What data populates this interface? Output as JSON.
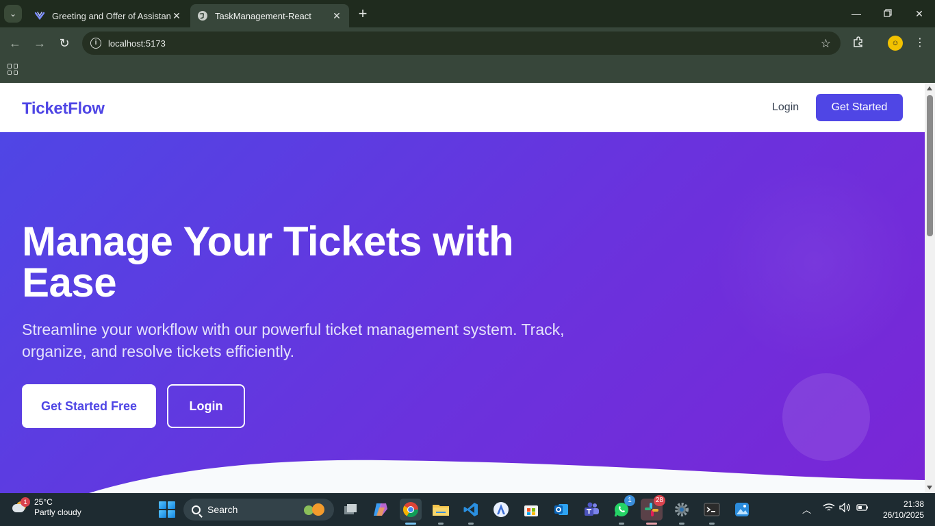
{
  "browser": {
    "tabs": [
      {
        "title": "Greeting and Offer of Assistance",
        "active": false
      },
      {
        "title": "TaskManagement-React",
        "active": true
      }
    ],
    "address": "localhost:5173"
  },
  "site": {
    "brand": "TicketFlow",
    "nav": {
      "login": "Login",
      "cta": "Get Started"
    }
  },
  "hero": {
    "headline": "Manage Your Tickets with Ease",
    "subtitle": "Streamline your workflow with our powerful ticket management system. Track, organize, and resolve tickets efficiently.",
    "primary_button": "Get Started Free",
    "secondary_button": "Login"
  },
  "colors": {
    "brand": "#4f46e5",
    "hero_gradient_start": "#4f46e5",
    "hero_gradient_end": "#7a26d6",
    "browser_frame": "#37463a",
    "taskbar": "#1e2b31"
  },
  "taskbar": {
    "weather": {
      "temp": "25°C",
      "condition": "Partly cloudy",
      "badge": "1"
    },
    "search_label": "Search",
    "apps": [
      {
        "name": "task-view",
        "badge": ""
      },
      {
        "name": "copilot",
        "badge": ""
      },
      {
        "name": "chrome",
        "badge": "",
        "active": true
      },
      {
        "name": "file-explorer",
        "badge": ""
      },
      {
        "name": "vscode",
        "badge": ""
      },
      {
        "name": "android-studio",
        "badge": ""
      },
      {
        "name": "microsoft-store",
        "badge": ""
      },
      {
        "name": "outlook",
        "badge": ""
      },
      {
        "name": "teams",
        "badge": ""
      },
      {
        "name": "whatsapp",
        "badge": "1"
      },
      {
        "name": "slack",
        "badge": "28"
      },
      {
        "name": "settings",
        "badge": ""
      },
      {
        "name": "terminal",
        "badge": ""
      },
      {
        "name": "photos",
        "badge": ""
      }
    ],
    "time": "21:38",
    "date": "26/10/2025"
  }
}
